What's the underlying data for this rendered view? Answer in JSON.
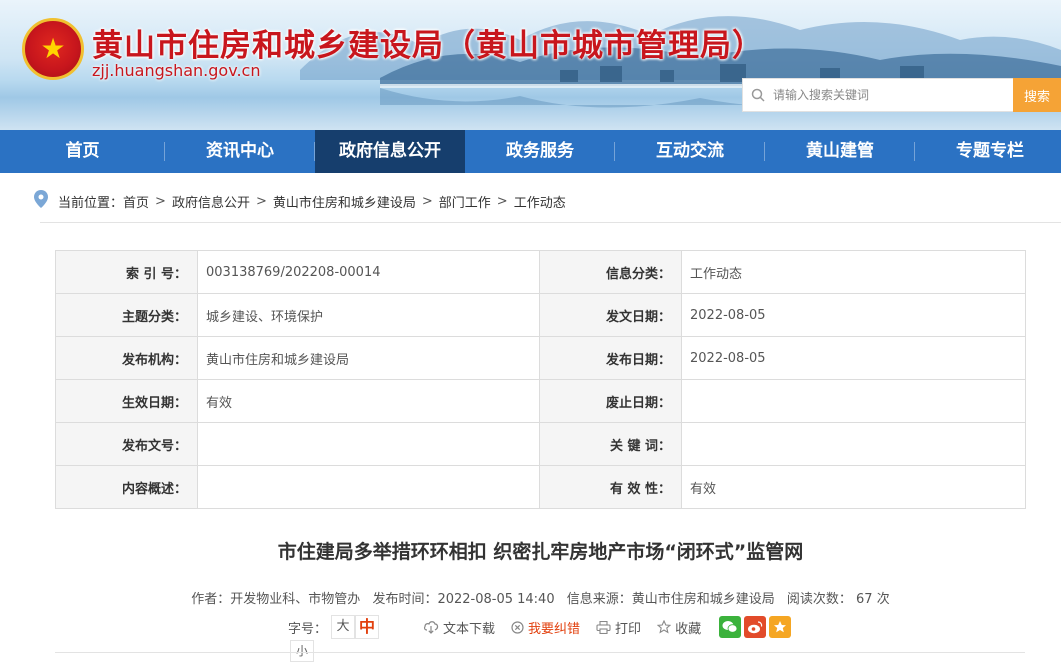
{
  "header": {
    "title": "黄山市住房和城乡建设局（黄山市城市管理局）",
    "url": "zjj.huangshan.gov.cn",
    "emblem_icon": "national-emblem-icon"
  },
  "search": {
    "placeholder": "请输入搜索关键词",
    "button_label": "搜索"
  },
  "nav": {
    "items": [
      {
        "label": "首页"
      },
      {
        "label": "资讯中心"
      },
      {
        "label": "政府信息公开"
      },
      {
        "label": "政务服务"
      },
      {
        "label": "互动交流"
      },
      {
        "label": "黄山建管"
      },
      {
        "label": "专题专栏"
      }
    ],
    "active_index": 2
  },
  "breadcrumb": {
    "prefix": "当前位置：",
    "items": [
      "首页",
      "政府信息公开",
      "黄山市住房和城乡建设局",
      "部门工作",
      "工作动态"
    ],
    "separator": ">"
  },
  "info": {
    "rows": [
      {
        "l_label": "索 引 号：",
        "l_value": "003138769/202208-00014",
        "r_label": "信息分类：",
        "r_value": "工作动态"
      },
      {
        "l_label": "主题分类：",
        "l_value": "城乡建设、环境保护",
        "r_label": "发文日期：",
        "r_value": "2022-08-05"
      },
      {
        "l_label": "发布机构：",
        "l_value": "黄山市住房和城乡建设局",
        "r_label": "发布日期：",
        "r_value": "2022-08-05"
      },
      {
        "l_label": "生效日期：",
        "l_value": "有效",
        "r_label": "废止日期：",
        "r_value": ""
      },
      {
        "l_label": "发布文号：",
        "l_value": "",
        "r_label": "关 键 词：",
        "r_value": ""
      },
      {
        "l_label": "内容概述：",
        "l_value": "",
        "r_label": "有 效 性：",
        "r_value": "有效"
      }
    ]
  },
  "article": {
    "title": "市住建局多举措环环相扣 织密扎牢房地产市场“闭环式”监管网",
    "author": "作者：开发物业科、市物管办",
    "publish_time": "发布时间：2022-08-05 14:40",
    "source": "信息来源：黄山市住房和城乡建设局",
    "views": "阅读次数： 67 次"
  },
  "tools": {
    "font_size_label": "字号：",
    "font_large": "大",
    "font_mid": "中",
    "font_small": "小",
    "download": "文本下载",
    "report_error": "我要纠错",
    "print": "打印",
    "favorite": "收藏"
  },
  "colors": {
    "nav_bg": "#2b72c3",
    "nav_active": "#163e6d",
    "title_red": "#c8161d",
    "search_button": "#f5a336",
    "accent_orange": "#e2400e"
  }
}
